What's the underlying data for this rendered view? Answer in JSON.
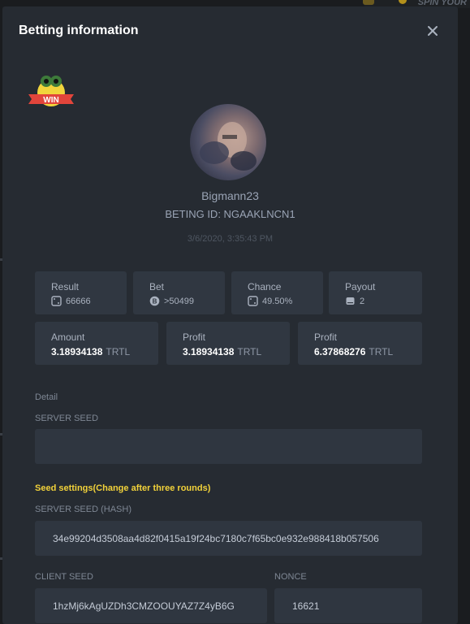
{
  "background": {
    "corner_label": "SPIN YOUR"
  },
  "modal": {
    "title": "Betting information",
    "close_icon": "close-icon"
  },
  "badge": {
    "text": "WIN"
  },
  "player": {
    "username": "Bigmann23",
    "bet_id": "BETING ID: NGAAKLNCN1",
    "timestamp": "3/6/2020, 3:35:43 PM"
  },
  "stats": [
    {
      "label": "Result",
      "icon": "dice-icon",
      "value": "66666"
    },
    {
      "label": "Bet",
      "icon": "coin-icon",
      "value": ">50499"
    },
    {
      "label": "Chance",
      "icon": "dice-icon",
      "value": "49.50%"
    },
    {
      "label": "Payout",
      "icon": "stack-icon",
      "value": "2"
    }
  ],
  "amounts": [
    {
      "label": "Amount",
      "value": "3.18934138",
      "currency": "TRTL"
    },
    {
      "label": "Profit",
      "value": "3.18934138",
      "currency": "TRTL"
    },
    {
      "label": "Profit",
      "value": "6.37868276",
      "currency": "TRTL"
    }
  ],
  "detail": {
    "heading": "Detail",
    "server_seed_label": "SERVER SEED",
    "server_seed_value": "",
    "seed_settings": "Seed settings(Change after three rounds)",
    "server_seed_hash_label": "SERVER SEED (HASH)",
    "server_seed_hash_value": "34e99204d3508aa4d82f0415a19f24bc7180c7f65bc0e932e988418b057506",
    "client_seed_label": "CLIENT SEED",
    "client_seed_value": "1hzMj6kAgUZDh3CMZOOUYAZ7Z4yB6G",
    "nonce_label": "NONCE",
    "nonce_value": "16621"
  },
  "colors": {
    "modal_bg": "#262b32",
    "card_bg": "#303741",
    "accent_yellow": "#f2d23a"
  }
}
